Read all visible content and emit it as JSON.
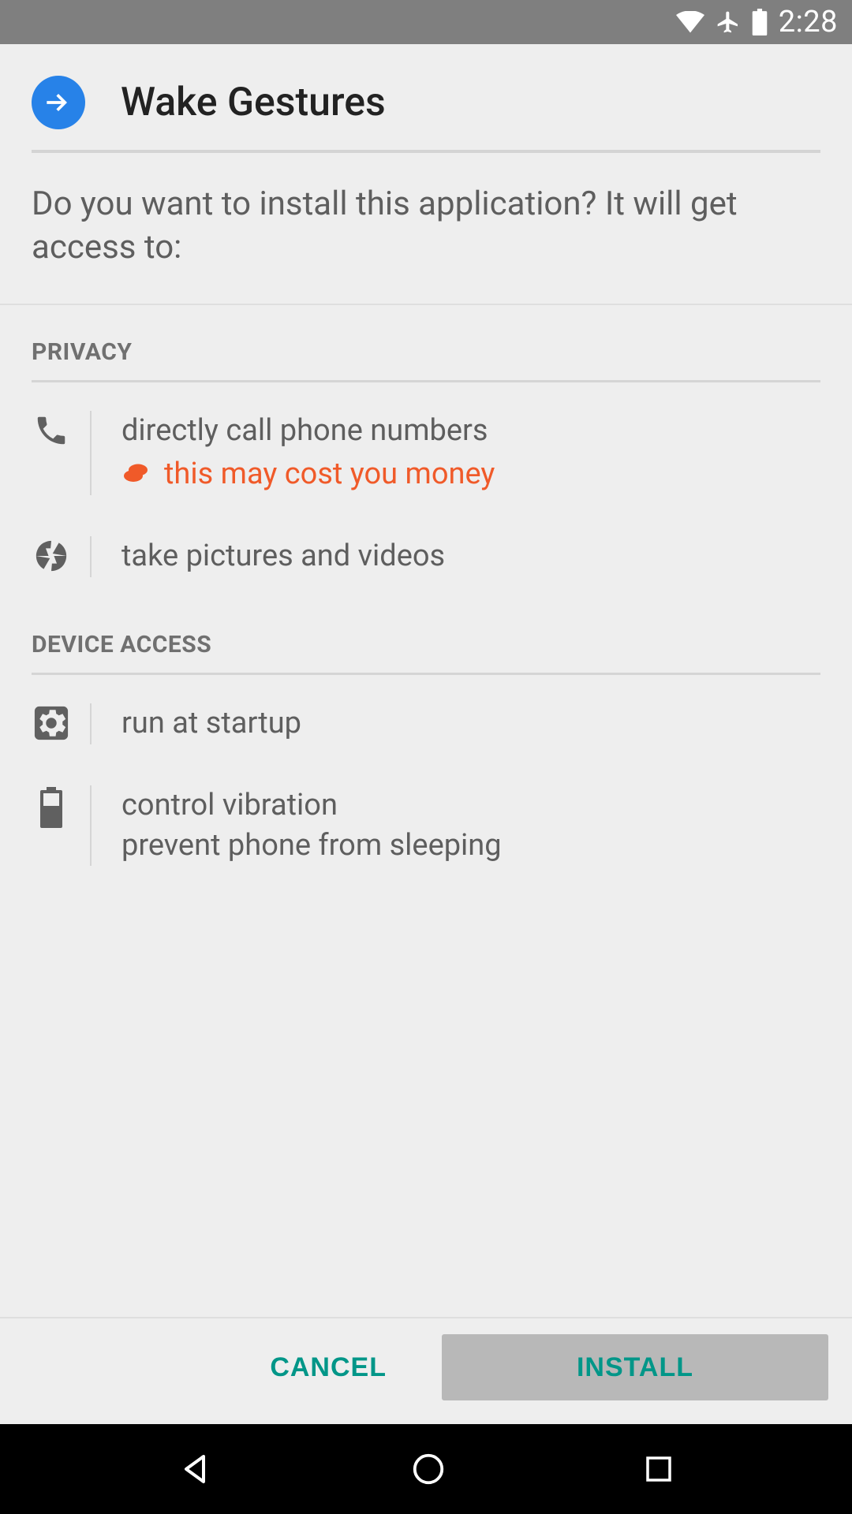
{
  "statusbar": {
    "time": "2:28"
  },
  "header": {
    "app_name": "Wake Gestures"
  },
  "intro": "Do you want to install this application? It will get access to:",
  "sections": {
    "privacy": {
      "title": "PRIVACY",
      "items": {
        "call": {
          "line1": "directly call phone numbers",
          "cost": "this may cost you money"
        },
        "camera": {
          "line1": "take pictures and videos"
        }
      }
    },
    "device_access": {
      "title": "DEVICE ACCESS",
      "items": {
        "startup": {
          "line1": "run at startup"
        },
        "battery": {
          "line1": "control vibration",
          "line2": "prevent phone from sleeping"
        }
      }
    }
  },
  "footer": {
    "cancel": "CANCEL",
    "install": "INSTALL"
  }
}
